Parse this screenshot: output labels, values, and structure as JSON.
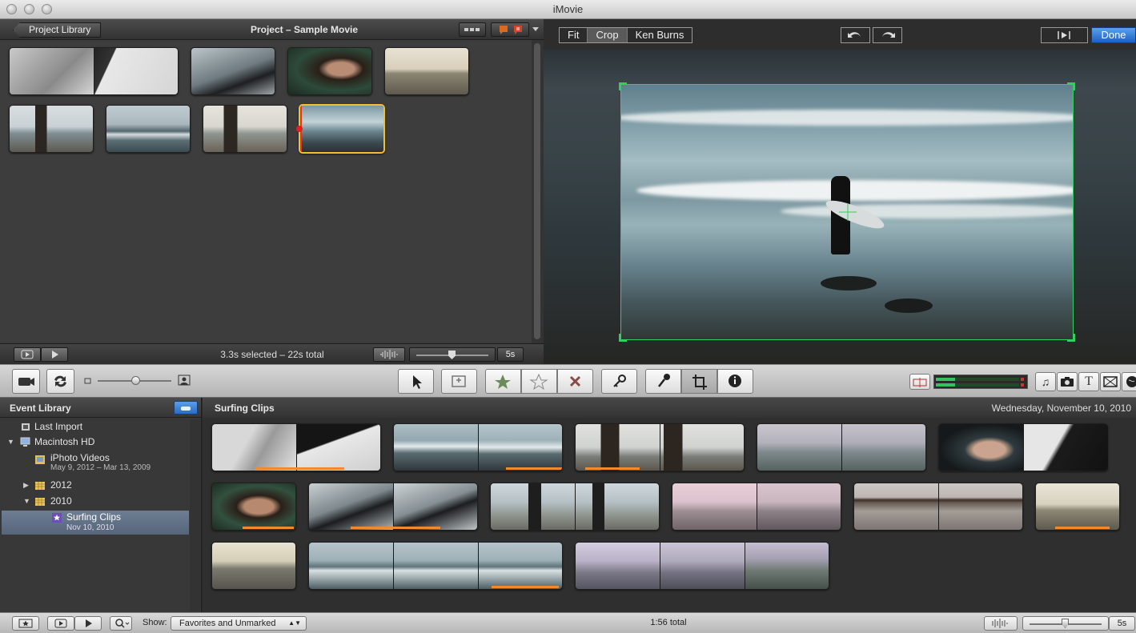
{
  "window": {
    "title": "iMovie"
  },
  "project": {
    "back_label": "Project Library",
    "title": "Project – Sample Movie",
    "status": "3.3s selected – 22s total",
    "duration": "5s"
  },
  "viewer": {
    "crop_modes": [
      "Fit",
      "Crop",
      "Ken Burns"
    ],
    "active_mode": "Crop",
    "done_label": "Done"
  },
  "event_library": {
    "heading": "Event Library",
    "items": [
      {
        "label": "Last Import",
        "sub": ""
      },
      {
        "label": "Macintosh HD",
        "sub": ""
      },
      {
        "label": "iPhoto Videos",
        "sub": "May 9, 2012 – Mar 13, 2009"
      },
      {
        "label": "2012",
        "sub": ""
      },
      {
        "label": "2010",
        "sub": ""
      },
      {
        "label": "Surfing Clips",
        "sub": "Nov 10, 2010"
      }
    ]
  },
  "browser": {
    "event_name": "Surfing Clips",
    "date": "Wednesday, November 10, 2010"
  },
  "footer": {
    "show_label": "Show:",
    "filter_value": "Favorites and Unmarked",
    "total": "1:56 total",
    "duration": "5s"
  },
  "colors": {
    "accent_green": "#32d05a",
    "selection_yellow": "#f0c030",
    "done_blue": "#2d73d6",
    "favorite_orange": "#f08a2c"
  }
}
